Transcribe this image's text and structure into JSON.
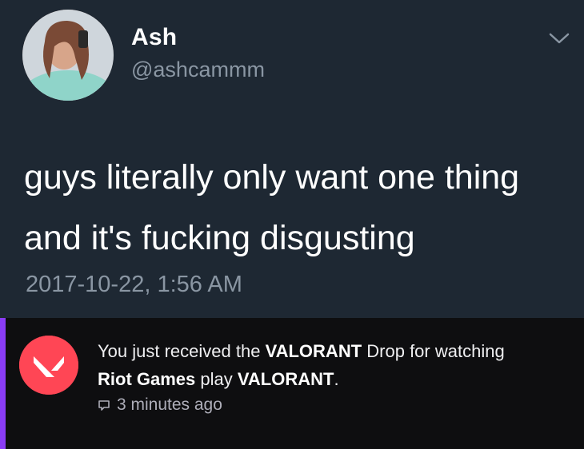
{
  "tweet": {
    "display_name": "Ash",
    "handle": "@ashcammm",
    "text_line1": "guys literally only want one thing",
    "text_line2": "and it's fucking disgusting",
    "timestamp": "2017-10-22, 1:56 AM",
    "avatar_icon": "profile-photo",
    "menu_icon": "chevron-down-icon"
  },
  "notification": {
    "prefix": "You just received the ",
    "game": "VALORANT",
    "middle": " Drop for watching",
    "channel": "Riot Games",
    "play_word": " play ",
    "game2": "VALORANT",
    "suffix": ".",
    "time": "3 minutes ago",
    "icon": "valorant-logo-icon",
    "time_icon": "chat-bubble-icon",
    "accent_color": "#8a3cf5",
    "icon_color": "#ff4655"
  }
}
